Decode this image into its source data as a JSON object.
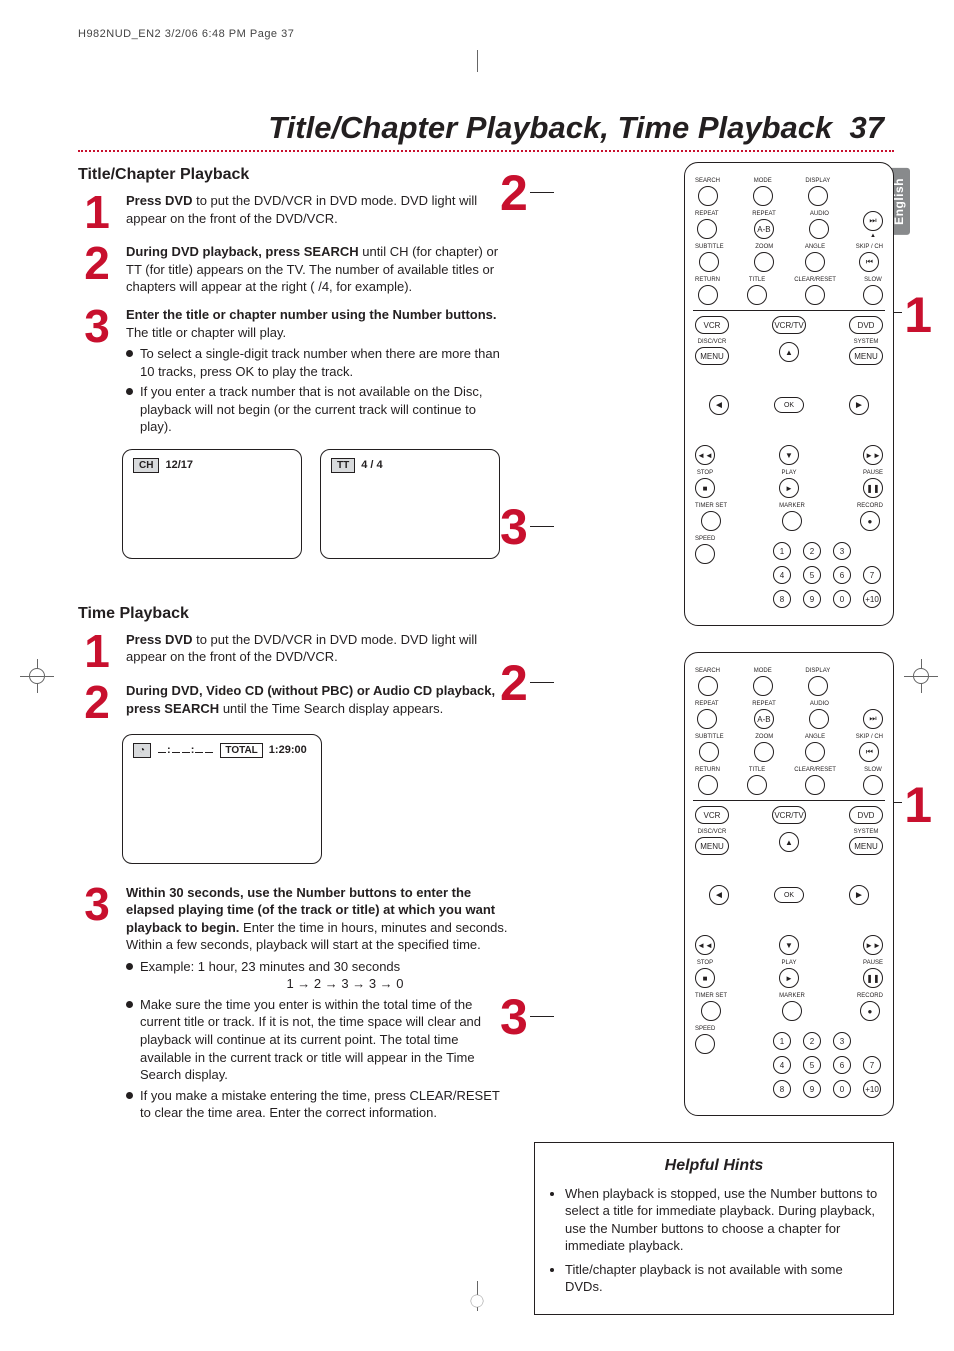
{
  "header": "H982NUD_EN2  3/2/06  6:48 PM  Page 37",
  "title": "Title/Chapter Playback, Time Playback",
  "page_num": "37",
  "lang_tab": "English",
  "section_a": {
    "heading": "Title/Chapter Playback",
    "step1_bold": "Press DVD",
    "step1_rest": " to put the DVD/VCR in DVD mode. DVD light will appear on the front of the DVD/VCR.",
    "step2_bold": "During DVD playback, press SEARCH",
    "step2_rest": " until CH (for chapter) or TT (for title) appears on the TV. The number of available titles or chapters will appear at the right (   /4, for example).",
    "step3_bold": "Enter the title or chapter number using the Number buttons.",
    "step3_rest": " The title or chapter will play.",
    "step3_bullets": [
      "To select a single-digit track number when there are more than 10 tracks, press OK to play the track.",
      "If you enter a track number that is not available on the Disc, playback will not begin (or the current track will continue to play)."
    ],
    "osd_left_badge": "CH",
    "osd_left_value": "12/17",
    "osd_right_badge": "TT",
    "osd_right_value": "4 / 4"
  },
  "section_b": {
    "heading": "Time Playback",
    "step1_bold": "Press DVD",
    "step1_rest": " to put the DVD/VCR in DVD mode. DVD light will appear on the front of the DVD/VCR.",
    "step2_bold": "During DVD, Video CD (without PBC) or Audio CD playback, press SEARCH",
    "step2_rest": " until the Time Search display appears.",
    "osd_total_label": "TOTAL",
    "osd_total_value": "1:29:00",
    "step3_bold": "Within 30 seconds, use the Number buttons to enter the elapsed playing time (of the track or title) at which you want playback to begin.",
    "step3_rest": " Enter the time in hours, minutes and seconds. Within a few seconds, playback will start at the specified time.",
    "step3_bullets": [
      "Example: 1 hour, 23 minutes and 30 seconds",
      "Make sure the time you enter is within the total time of the current title or track. If it is not, the time space will clear and playback will continue at its current point. The total time available in the current track or title will appear in the Time Search display.",
      "If you make a mistake entering the time, press CLEAR/RESET to clear the time area. Enter the correct information."
    ],
    "example_sequence": "1 → 2 → 3 → 3 → 0"
  },
  "remote": {
    "row1": [
      "SEARCH",
      "MODE",
      "DISPLAY"
    ],
    "row2": [
      "REPEAT",
      "REPEAT",
      "AUDIO"
    ],
    "row2b_label": "A-B",
    "row3": [
      "SUBTITLE",
      "ZOOM",
      "ANGLE",
      "SKIP / CH"
    ],
    "row4": [
      "RETURN",
      "TITLE",
      "CLEAR/RESET",
      "SLOW"
    ],
    "source_row": [
      "VCR",
      "VCR/TV",
      "DVD"
    ],
    "menu_left_label": "DISC/VCR",
    "menu_right_label": "SYSTEM",
    "menu_left": "MENU",
    "menu_right": "MENU",
    "ok": "OK",
    "transport_row1": [
      "◄◄",
      "▼",
      "►►"
    ],
    "transport_row2_labels": [
      "STOP",
      "PLAY",
      "PAUSE"
    ],
    "transport_row2_glyphs": [
      "■",
      "►",
      "❚❚"
    ],
    "bottom_labels": [
      "TIMER SET",
      "MARKER",
      "RECORD"
    ],
    "record_glyph": "●",
    "speed_label": "SPEED",
    "numbers": [
      "1",
      "2",
      "3",
      "4",
      "5",
      "6",
      "7",
      "8",
      "9",
      "0",
      "+10"
    ]
  },
  "hints": {
    "heading": "Helpful Hints",
    "items": [
      "When playback is stopped, use the Number buttons to select a title for immediate playback. During playback, use the Number buttons to choose a chapter for immediate playback.",
      "Title/chapter playback is not available with some DVDs."
    ]
  }
}
